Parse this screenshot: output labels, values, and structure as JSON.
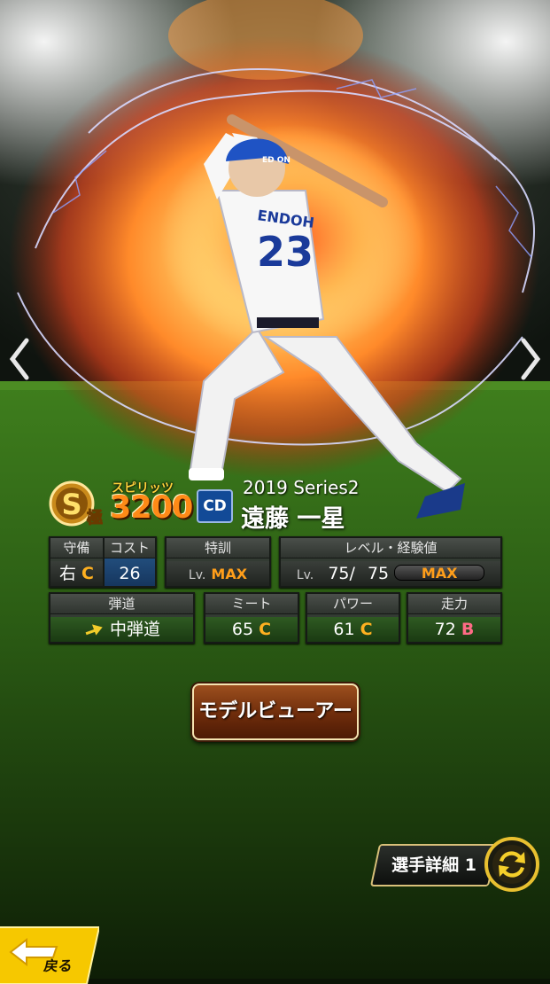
{
  "colors": {
    "spirits": "#ff8a17",
    "grade_c": "#ffb020",
    "grade_b": "#ff6b86",
    "max": "#ff9e1a",
    "team_blue": "#124a97",
    "back_yellow": "#f6c800"
  },
  "nav": {
    "prev_icon": "chevron-left-icon",
    "next_icon": "chevron-right-icon"
  },
  "player": {
    "rank_icon": "s-rank-kiwami-badge-icon",
    "rank_letter": "S",
    "rank_kanji": "極",
    "spirits_label": "スピリッツ",
    "spirits_value": "3200",
    "team_logo": "CD",
    "series": "2019 Series2",
    "name": "遠藤 一星",
    "uniform_number": "23",
    "cap_text": "ED ON",
    "jersey_name": "ENDOH"
  },
  "stats": {
    "position": {
      "header": "守備",
      "value": "右",
      "grade": "C"
    },
    "cost": {
      "header": "コスト",
      "value": "26"
    },
    "training": {
      "header": "特訓",
      "prefix": "Lv.",
      "value": "MAX"
    },
    "level": {
      "header": "レベル・経験値",
      "prefix": "Lv.",
      "current": "75",
      "sep": "/",
      "max": "75",
      "exp_label": "MAX"
    },
    "trajectory": {
      "header": "弾道",
      "value": "中弾道",
      "icon": "arrow-right-icon"
    },
    "meet": {
      "header": "ミート",
      "value": "65",
      "grade": "C"
    },
    "power": {
      "header": "パワー",
      "value": "61",
      "grade": "C"
    },
    "speed": {
      "header": "走力",
      "value": "72",
      "grade": "B"
    }
  },
  "buttons": {
    "model_viewer": "モデルビューアー",
    "player_detail": "選手詳細 1",
    "swap_icon": "swap-arrows-icon",
    "back": "戻る"
  }
}
